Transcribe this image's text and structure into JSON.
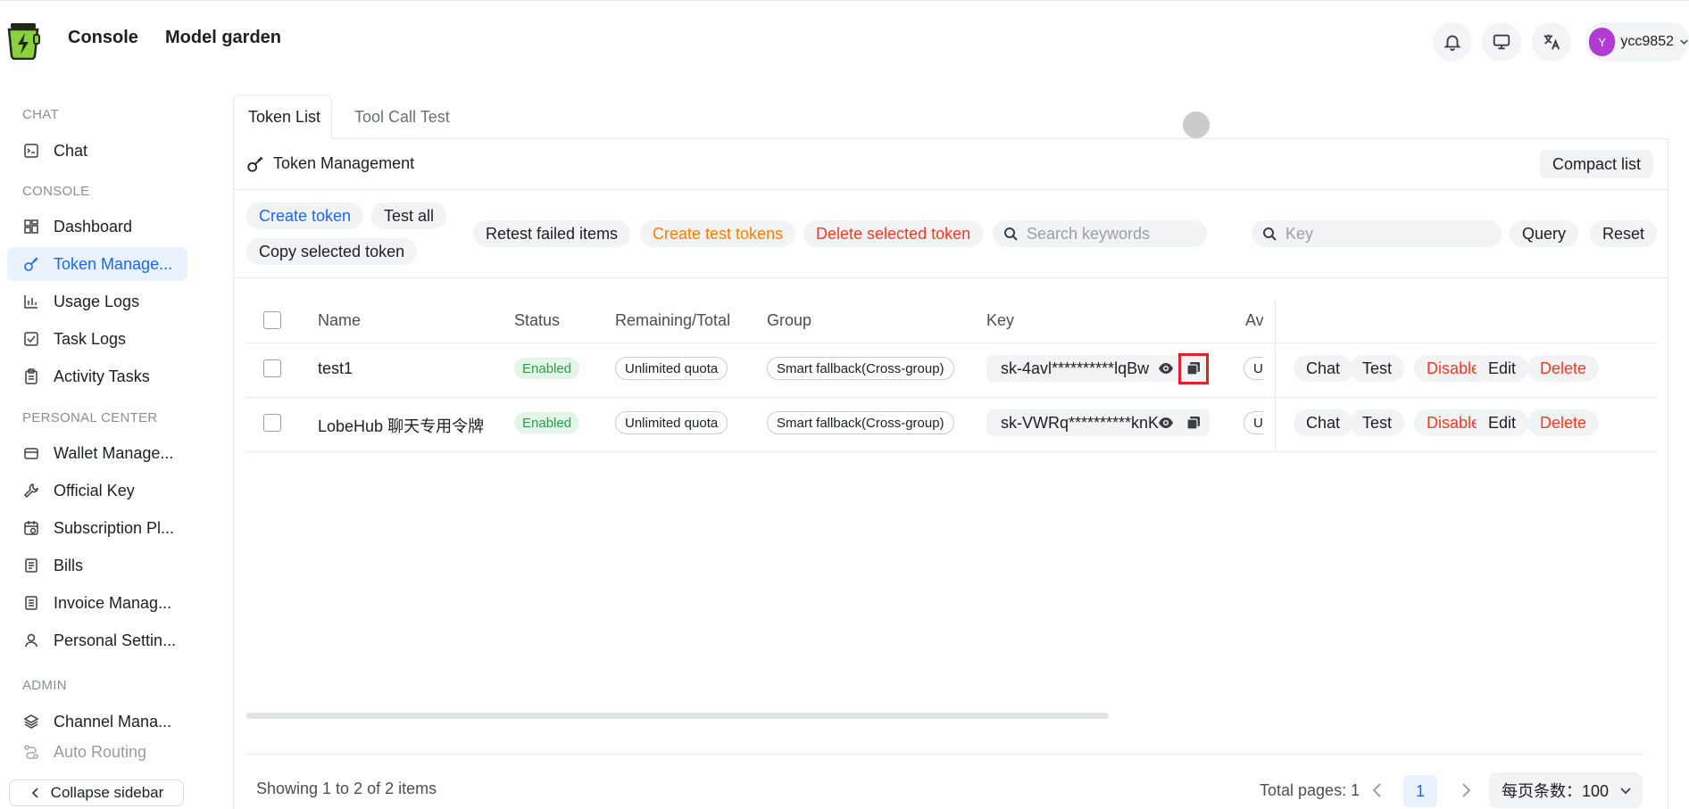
{
  "header": {
    "nav": [
      "Console",
      "Model garden"
    ],
    "user": {
      "initial": "Y",
      "name": "ycc9852"
    },
    "icons": [
      "bell-icon",
      "monitor-icon",
      "translate-icon"
    ]
  },
  "sidebar": {
    "sections": [
      {
        "title": "CHAT",
        "items": [
          {
            "label": "Chat",
            "icon": "chat-icon"
          }
        ]
      },
      {
        "title": "CONSOLE",
        "items": [
          {
            "label": "Dashboard",
            "icon": "dashboard-icon"
          },
          {
            "label": "Token Manage...",
            "icon": "key-icon",
            "active": true
          },
          {
            "label": "Usage Logs",
            "icon": "bar-chart-icon"
          },
          {
            "label": "Task Logs",
            "icon": "checkbox-icon"
          },
          {
            "label": "Activity Tasks",
            "icon": "clipboard-icon"
          }
        ]
      },
      {
        "title": "PERSONAL CENTER",
        "items": [
          {
            "label": "Wallet Manage...",
            "icon": "credit-card-icon"
          },
          {
            "label": "Official Key",
            "icon": "wrench-icon"
          },
          {
            "label": "Subscription Pl...",
            "icon": "calendar-clock-icon"
          },
          {
            "label": "Bills",
            "icon": "document-icon"
          },
          {
            "label": "Invoice Manag...",
            "icon": "invoice-icon"
          },
          {
            "label": "Personal Settin...",
            "icon": "user-icon"
          }
        ]
      },
      {
        "title": "ADMIN",
        "items": [
          {
            "label": "Channel Mana...",
            "icon": "layers-icon"
          },
          {
            "label": "Auto Routing",
            "icon": "routing-icon"
          }
        ]
      }
    ],
    "collapse_label": "Collapse sidebar"
  },
  "tabs": [
    {
      "label": "Token List",
      "active": true
    },
    {
      "label": "Tool Call Test"
    }
  ],
  "card": {
    "title": "Token Management",
    "compact_label": "Compact list"
  },
  "toolbar": {
    "create_token": "Create token",
    "test_all": "Test all",
    "copy_selected": "Copy selected token",
    "retest_failed": "Retest failed items",
    "create_test_tokens": "Create test tokens",
    "delete_selected": "Delete selected token",
    "search_placeholder": "Search keywords",
    "key_placeholder": "Key",
    "query": "Query",
    "reset": "Reset"
  },
  "table": {
    "columns": [
      "Name",
      "Status",
      "Remaining/Total",
      "Group",
      "Key",
      "Av"
    ],
    "rows": [
      {
        "name": "test1",
        "status": "Enabled",
        "quota": "Unlimited quota",
        "group": "Smart fallback(Cross-group)",
        "key": "sk-4avl**********lqBw",
        "avail": "U"
      },
      {
        "name": "LobeHub 聊天专用令牌",
        "status": "Enabled",
        "quota": "Unlimited quota",
        "group": "Smart fallback(Cross-group)",
        "key": "sk-VWRq**********knK",
        "avail": "U"
      }
    ],
    "actions": [
      "Chat",
      "Test",
      "Disable",
      "Edit",
      "Delete"
    ]
  },
  "footer": {
    "showing": "Showing 1 to 2 of 2 items",
    "total_pages": "Total pages: 1",
    "current_page": "1",
    "page_size": "每页条数：100"
  },
  "colors": {
    "accent": "#1a66ff",
    "danger": "#f93920",
    "warning": "#ff7d00",
    "success": "#2c9a4e",
    "highlight": "#e5202d"
  }
}
